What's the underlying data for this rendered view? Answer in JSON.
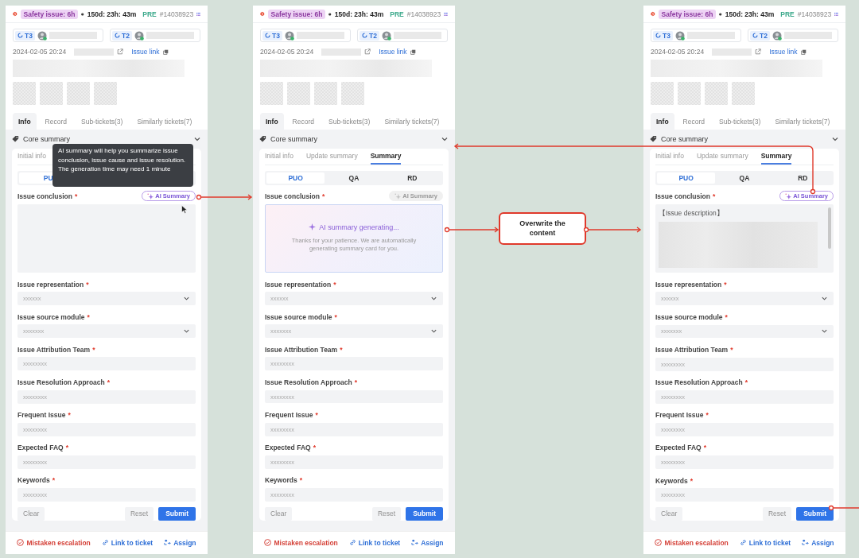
{
  "panels": [
    {
      "header": {
        "badge": "Safety issue: 6h",
        "timer": "150d: 23h: 43m",
        "env": "PRE",
        "ticket": "#14038923"
      },
      "assignees": [
        {
          "tier": "T3"
        },
        {
          "tier": "T2"
        }
      ],
      "meta": {
        "date": "2024-02-05 20:24",
        "link": "Issue link"
      },
      "tabs": [
        {
          "label": "Info",
          "selected": true
        },
        {
          "label": "Record",
          "selected": false
        },
        {
          "label": "Sub-tickets(3)",
          "selected": false
        },
        {
          "label": "Similarly tickets(7)",
          "selected": false
        }
      ],
      "section": {
        "title": "Core summary",
        "expanded": true
      },
      "subtabs": [
        {
          "label": "Initial info",
          "selected": false
        }
      ],
      "segments": [
        {
          "label": "PU",
          "selected": true
        }
      ],
      "tooltip": "AI summary will help you summarize issue conclusion, issue cause and issue resolution. The generation time may need 1 minute",
      "conclusion": {
        "label": "Issue conclusion",
        "required": "*",
        "ai_button": "AI Summary",
        "ai_disabled": false,
        "kind": "empty"
      },
      "fields": [
        {
          "label": "Issue representation",
          "required": "*",
          "kind": "select",
          "value": "xxxxxx"
        },
        {
          "label": "Issue source module",
          "required": "*",
          "kind": "select",
          "value": "xxxxxxx"
        },
        {
          "label": "Issue Attribution Team",
          "required": "*",
          "kind": "input",
          "value": "xxxxxxxx"
        },
        {
          "label": "Issue Resolution Approach",
          "required": "*",
          "kind": "input",
          "value": "xxxxxxxx"
        },
        {
          "label": "Frequent Issue",
          "required": "*",
          "kind": "input",
          "value": "xxxxxxxx"
        },
        {
          "label": "Expected FAQ",
          "required": "*",
          "kind": "input",
          "value": "xxxxxxxx"
        },
        {
          "label": "Keywords",
          "required": "*",
          "kind": "input",
          "value": "xxxxxxxx"
        }
      ],
      "actions": {
        "clear": "Clear",
        "reset": "Reset",
        "submit": "Submit"
      },
      "footer": [
        {
          "label": "Mistaken escalation",
          "kind": "danger"
        },
        {
          "label": "Link to ticket",
          "kind": "link"
        },
        {
          "label": "Assign",
          "kind": "assign"
        }
      ]
    },
    {
      "header": {
        "badge": "Safety issue: 6h",
        "timer": "150d: 23h: 43m",
        "env": "PRE",
        "ticket": "#14038923"
      },
      "assignees": [
        {
          "tier": "T3"
        },
        {
          "tier": "T2"
        }
      ],
      "meta": {
        "date": "2024-02-05 20:24",
        "link": "Issue link"
      },
      "tabs": [
        {
          "label": "Info",
          "selected": true
        },
        {
          "label": "Record",
          "selected": false
        },
        {
          "label": "Sub-tickets(3)",
          "selected": false
        },
        {
          "label": "Similarly tickets(7)",
          "selected": false
        }
      ],
      "section": {
        "title": "Core summary",
        "expanded": true
      },
      "subtabs": [
        {
          "label": "Initial info",
          "selected": false
        },
        {
          "label": "Update summary",
          "selected": false
        },
        {
          "label": "Summary",
          "selected": true
        }
      ],
      "segments": [
        {
          "label": "PUO",
          "selected": true
        },
        {
          "label": "QA",
          "selected": false
        },
        {
          "label": "RD",
          "selected": false
        }
      ],
      "conclusion": {
        "label": "Issue conclusion",
        "required": "*",
        "ai_button": "AI Summary",
        "ai_disabled": true,
        "kind": "generating",
        "title": "AI summary generating...",
        "note": "Thanks for your patience. We are automatically generating summary card for you."
      },
      "fields": [
        {
          "label": "Issue representation",
          "required": "*",
          "kind": "select",
          "value": "xxxxxx"
        },
        {
          "label": "Issue source module",
          "required": "*",
          "kind": "select",
          "value": "xxxxxxx"
        },
        {
          "label": "Issue Attribution Team",
          "required": "*",
          "kind": "input",
          "value": "xxxxxxxx"
        },
        {
          "label": "Issue Resolution Approach",
          "required": "*",
          "kind": "input",
          "value": "xxxxxxxx"
        },
        {
          "label": "Frequent Issue",
          "required": "*",
          "kind": "input",
          "value": "xxxxxxxx"
        },
        {
          "label": "Expected FAQ",
          "required": "*",
          "kind": "input",
          "value": "xxxxxxxx"
        },
        {
          "label": "Keywords",
          "required": "*",
          "kind": "input",
          "value": "xxxxxxxx"
        }
      ],
      "actions": {
        "clear": "Clear",
        "reset": "Reset",
        "submit": "Submit"
      },
      "footer": [
        {
          "label": "Mistaken escalation",
          "kind": "danger"
        },
        {
          "label": "Link to ticket",
          "kind": "link"
        },
        {
          "label": "Assign",
          "kind": "assign"
        }
      ]
    },
    {
      "header": {
        "badge": "Safety issue: 6h",
        "timer": "150d: 23h: 43m",
        "env": "PRE",
        "ticket": "#14038923"
      },
      "assignees": [
        {
          "tier": "T3"
        },
        {
          "tier": "T2"
        }
      ],
      "meta": {
        "date": "2024-02-05 20:24",
        "link": "Issue link"
      },
      "tabs": [
        {
          "label": "Info",
          "selected": true
        },
        {
          "label": "Record",
          "selected": false
        },
        {
          "label": "Sub-tickets(3)",
          "selected": false
        },
        {
          "label": "Similarly tickets(7)",
          "selected": false
        }
      ],
      "section": {
        "title": "Core summary",
        "expanded": true
      },
      "subtabs": [
        {
          "label": "Initial info",
          "selected": false
        },
        {
          "label": "Update summary",
          "selected": false
        },
        {
          "label": "Summary",
          "selected": true
        }
      ],
      "segments": [
        {
          "label": "PUO",
          "selected": true
        },
        {
          "label": "QA",
          "selected": false
        },
        {
          "label": "RD",
          "selected": false
        }
      ],
      "conclusion": {
        "label": "Issue conclusion",
        "required": "*",
        "ai_button": "AI Summary",
        "ai_disabled": false,
        "kind": "filled",
        "text": "【Issue description】"
      },
      "fields": [
        {
          "label": "Issue representation",
          "required": "*",
          "kind": "select",
          "value": "xxxxxx"
        },
        {
          "label": "Issue source module",
          "required": "*",
          "kind": "select",
          "value": "xxxxxxx"
        },
        {
          "label": "Issue Attribution Team",
          "required": "*",
          "kind": "input",
          "value": "xxxxxxxx"
        },
        {
          "label": "Issue Resolution Approach",
          "required": "*",
          "kind": "input",
          "value": "xxxxxxxx"
        },
        {
          "label": "Frequent Issue",
          "required": "*",
          "kind": "input",
          "value": "xxxxxxxx"
        },
        {
          "label": "Expected FAQ",
          "required": "*",
          "kind": "input",
          "value": "xxxxxxxx"
        },
        {
          "label": "Keywords",
          "required": "*",
          "kind": "input",
          "value": "xxxxxxxx"
        }
      ],
      "actions": {
        "clear": "Clear",
        "reset": "Reset",
        "submit": "Submit"
      },
      "footer": [
        {
          "label": "Mistaken escalation",
          "kind": "danger"
        },
        {
          "label": "Link to ticket",
          "kind": "link"
        },
        {
          "label": "Assign",
          "kind": "assign"
        }
      ]
    }
  ],
  "callout": {
    "text": "Overwrite the content"
  }
}
